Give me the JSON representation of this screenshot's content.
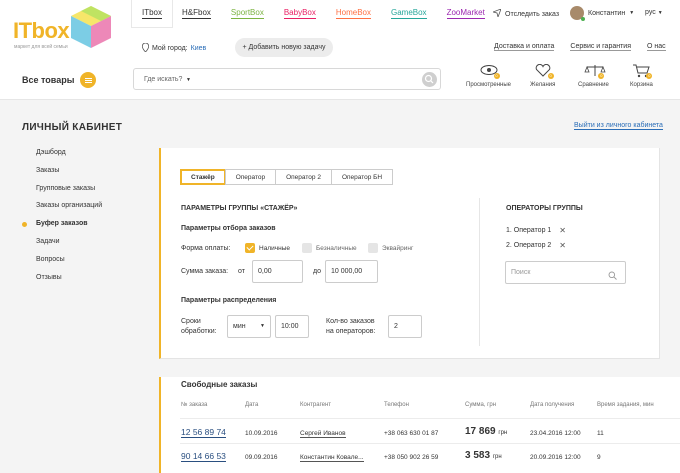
{
  "brand": {
    "name": "ITbox",
    "tagline": "маркет для всей семьи",
    "accent": "#f0b428"
  },
  "nav": {
    "tabs": [
      {
        "label": "ITbox",
        "color": "#333333",
        "active": true
      },
      {
        "label": "H&Fbox",
        "color": "#333333"
      },
      {
        "label": "SportBox",
        "color": "#7cb342"
      },
      {
        "label": "BabyBox",
        "color": "#e91e63"
      },
      {
        "label": "HomeBox",
        "color": "#ff7043"
      },
      {
        "label": "GameBox",
        "color": "#26a69a"
      },
      {
        "label": "ZooMarket",
        "color": "#9c27b0"
      }
    ],
    "track_order": "Отследить заказ",
    "user_name": "Константин",
    "lang": "рус"
  },
  "subheader": {
    "city_label": "Мой город:",
    "city_value": "Киев",
    "add_task": "+ Добавить новую задачу",
    "links": [
      "Доставка и оплата",
      "Сервис и гарантия",
      "О нас"
    ]
  },
  "search": {
    "all_goods": "Все товары",
    "placeholder": "Где искать?"
  },
  "tools": [
    {
      "label": "Просмотренные",
      "icon": "eye-icon",
      "count": "0"
    },
    {
      "label": "Желания",
      "icon": "heart-icon",
      "count": "0"
    },
    {
      "label": "Сравнение",
      "icon": "scales-icon",
      "count": "0"
    },
    {
      "label": "Корзина",
      "icon": "cart-icon",
      "count": "0"
    }
  ],
  "page": {
    "title": "ЛИЧНЫЙ КАБИНЕТ",
    "logout": "Выйти из личного кабинета"
  },
  "sidebar": {
    "items": [
      {
        "label": "Дэшборд"
      },
      {
        "label": "Заказы"
      },
      {
        "label": "Групповые заказы"
      },
      {
        "label": "Заказы организаций"
      },
      {
        "label": "Буфер заказов",
        "active": true
      },
      {
        "label": "Задачи"
      },
      {
        "label": "Вопросы"
      },
      {
        "label": "Отзывы"
      }
    ]
  },
  "group": {
    "tabs": [
      "Стажёр",
      "Оператор",
      "Оператор 2",
      "Оператор БН"
    ],
    "params_title": "ПАРАМЕТРЫ ГРУППЫ «СТАЖЁР»",
    "filter_title": "Параметры отбора заказов",
    "payment_label": "Форма оплаты:",
    "payment_options": [
      {
        "label": "Наличные",
        "checked": true
      },
      {
        "label": "Безналичные",
        "checked": false
      },
      {
        "label": "Эквайринг",
        "checked": false
      }
    ],
    "sum_label": "Сумма заказа:",
    "from_label": "от",
    "from_value": "0,00",
    "to_label": "до",
    "to_value": "10 000,00",
    "dist_title": "Параметры распределения",
    "terms_label": [
      "Сроки",
      "обработки:"
    ],
    "unit": "мин",
    "terms_value": "10:00",
    "count_label": [
      "Кол-во заказов",
      "на операторов:"
    ],
    "count_value": "2",
    "operators_title": "ОПЕРАТОРЫ ГРУППЫ",
    "operators": [
      "1. Оператор 1",
      "2. Оператор 2"
    ],
    "operator_search_placeholder": "Поиск"
  },
  "orders": {
    "title": "Свободные заказы",
    "columns": [
      "№ заказа",
      "Дата",
      "Контрагент",
      "Телефон",
      "Сумма, грн",
      "Дата получения",
      "Время задания, мин"
    ],
    "rows": [
      {
        "number": "12 56 89 74",
        "date": "10.09.2016",
        "contractor": "Сергей Иванов",
        "phone": "+38 063 630 01 87",
        "sum": "17 869",
        "currency": "грн",
        "received": "23.04.2016 12:00",
        "time": "11"
      },
      {
        "number": "90 14 66 53",
        "date": "09.09.2016",
        "contractor": "Константин Ковале...",
        "phone": "+38 050 902 26 59",
        "sum": "3 583",
        "currency": "грн",
        "received": "20.09.2016 12:00",
        "time": "9"
      }
    ]
  }
}
